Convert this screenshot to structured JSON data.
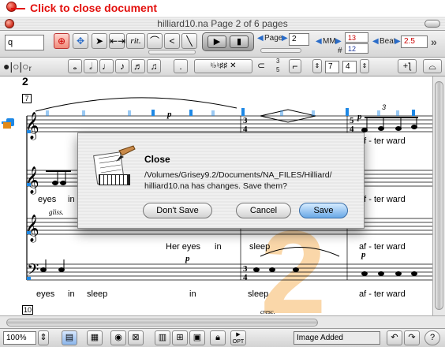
{
  "annotation": {
    "text": "Click to close document"
  },
  "window": {
    "title": "hilliard10.na Page 2 of 6 pages"
  },
  "toolbar": {
    "search_value": "q",
    "rit_label": "rit.",
    "page_label": "Page",
    "page_value": "2",
    "mm_label": "MM",
    "mm_values": [
      "13",
      "12"
    ],
    "mm_hash": "#",
    "beat_label": "Beat",
    "beat_value": "2.5",
    "overflow": "»"
  },
  "notebar": {
    "tuplet_top": "3",
    "tuplet_bottom": "5",
    "meter_num": "7",
    "meter_den": "4"
  },
  "score": {
    "system_number": "2",
    "measure_box": "7",
    "next_system_number": "10",
    "lyrics_top_right": "af - ter ward",
    "lyrics_row2_left": [
      "eyes",
      "in"
    ],
    "lyrics_row2_right": "af - ter ward",
    "lyrics_row3": [
      "Her eyes",
      "in",
      "sleep",
      "af - ter ward"
    ],
    "lyrics_row4": [
      "eyes",
      "in",
      "sleep",
      "in",
      "sleep",
      "af - ter ward"
    ],
    "dynamics": [
      "p",
      "p",
      "p",
      "p"
    ],
    "gliss": "gliss.",
    "cresc": "cresc.",
    "tuplet": "3",
    "time_sig_top": "3",
    "time_sig_bottom": "4",
    "time_sig2_top": "5",
    "time_sig2_bottom": "4",
    "watermark": "2"
  },
  "dialog": {
    "title": "Close",
    "message": "/Volumes/Grisey9.2/Documents/NA_FILES/Hilliard/ hilliard10.na has changes. Save them?",
    "dont_save": "Don't Save",
    "cancel": "Cancel",
    "save": "Save"
  },
  "status": {
    "zoom": "100%",
    "message": "Image Added",
    "opt_label": "OPT",
    "help": "?"
  },
  "colors": {
    "annotation_red": "#e3100d",
    "accent_blue": "#1e88e5",
    "watermark_orange": "#f4a640"
  }
}
